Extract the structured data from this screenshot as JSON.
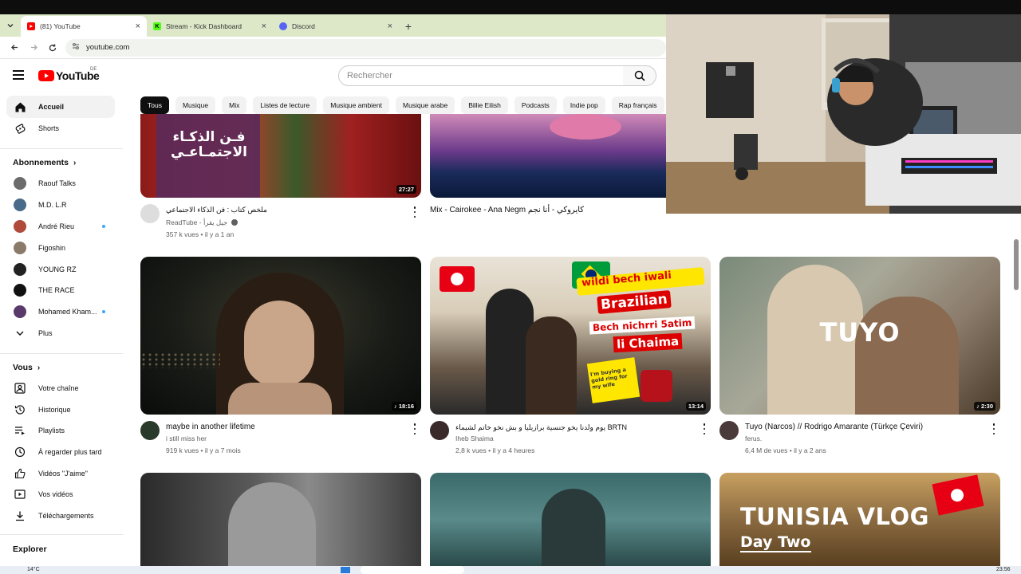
{
  "browser": {
    "tabs": [
      {
        "title": "(81) YouTube",
        "active": true
      },
      {
        "title": "Stream - Kick Dashboard",
        "active": false
      },
      {
        "title": "Discord",
        "active": false
      }
    ],
    "url": "youtube.com",
    "new_tab": "+",
    "close": "×"
  },
  "masthead": {
    "logo_text": "YouTube",
    "country_code": "DE",
    "search_placeholder": "Rechercher"
  },
  "sidebar": {
    "main": [
      {
        "label": "Accueil",
        "icon": "home-icon",
        "active": true
      },
      {
        "label": "Shorts",
        "icon": "shorts-icon"
      }
    ],
    "subscriptions_title": "Abonnements",
    "subscriptions": [
      {
        "label": "Raouf Talks",
        "color": "#6b6b6b",
        "dot": false
      },
      {
        "label": "M.D. L.R",
        "color": "#4a6a8a",
        "dot": false
      },
      {
        "label": "André Rieu",
        "color": "#b04a3a",
        "dot": true
      },
      {
        "label": "Figoshin",
        "color": "#8a7a6a",
        "dot": false
      },
      {
        "label": "YOUNG RZ",
        "color": "#222222",
        "dot": false
      },
      {
        "label": "THE RACE",
        "color": "#111111",
        "dot": false
      },
      {
        "label": "Mohamed Kham...",
        "color": "#5a3a6a",
        "dot": true
      }
    ],
    "more_label": "Plus",
    "you_title": "Vous",
    "you": [
      {
        "label": "Votre chaîne",
        "icon": "channel-icon"
      },
      {
        "label": "Historique",
        "icon": "history-icon"
      },
      {
        "label": "Playlists",
        "icon": "playlists-icon"
      },
      {
        "label": "À regarder plus tard",
        "icon": "watch-later-icon"
      },
      {
        "label": "Vidéos \"J'aime\"",
        "icon": "like-icon"
      },
      {
        "label": "Vos vidéos",
        "icon": "your-videos-icon"
      },
      {
        "label": "Téléchargements",
        "icon": "download-icon"
      }
    ],
    "explore_title": "Explorer"
  },
  "chips": [
    "Tous",
    "Musique",
    "Mix",
    "Listes de lecture",
    "Musique ambient",
    "Musique arabe",
    "Billie Eilish",
    "Podcasts",
    "Indie pop",
    "Rap français"
  ],
  "videos": [
    {
      "title": "ملخص كتاب : فن الذكاء الاجتماعي",
      "channel": "ReadTube - جيل يقرأ",
      "verified": true,
      "views": "357 k vues",
      "age": "il y a 1 an",
      "duration": "27:27",
      "thumb_text": "فـن الذكـاء الاجتمـاعـي"
    },
    {
      "title": "Mix - Cairokee - Ana Negm  كايروكي - أنا نجم",
      "channel": "",
      "views": "",
      "age": "",
      "duration": ""
    },
    {
      "title": "maybe in another lifetime",
      "channel": "i still miss her",
      "views": "919 k vues",
      "age": "il y a 7 mois",
      "duration": "18:16"
    },
    {
      "title": "يوم ولدنا يخو جنسية برازيليا و بش نخو خاتم لشيماء BRTN",
      "channel": "Iheb Shaima",
      "views": "2,8 k vues",
      "age": "il y a 4 heures",
      "duration": "13:14",
      "thumb_text": [
        "wildi bech iwali",
        "Brazilian",
        "Bech nichrri 5atim",
        "li Chaima",
        "I'm buying a gold ring for my wife"
      ]
    },
    {
      "title": "Tuyo (Narcos) // Rodrigo Amarante (Türkçe Çeviri)",
      "channel": "ferus.",
      "views": "6,4 M de vues",
      "age": "il y a 2 ans",
      "duration": "2:30",
      "thumb_text": "TUYO"
    },
    {
      "title": "",
      "duration": ""
    },
    {
      "title": "",
      "duration": ""
    },
    {
      "title": "",
      "duration": "",
      "thumb_text": [
        "TUNISIA VLOG",
        "Day Two"
      ]
    }
  ],
  "taskbar": {
    "weather": "14°C",
    "time": "23:56"
  }
}
